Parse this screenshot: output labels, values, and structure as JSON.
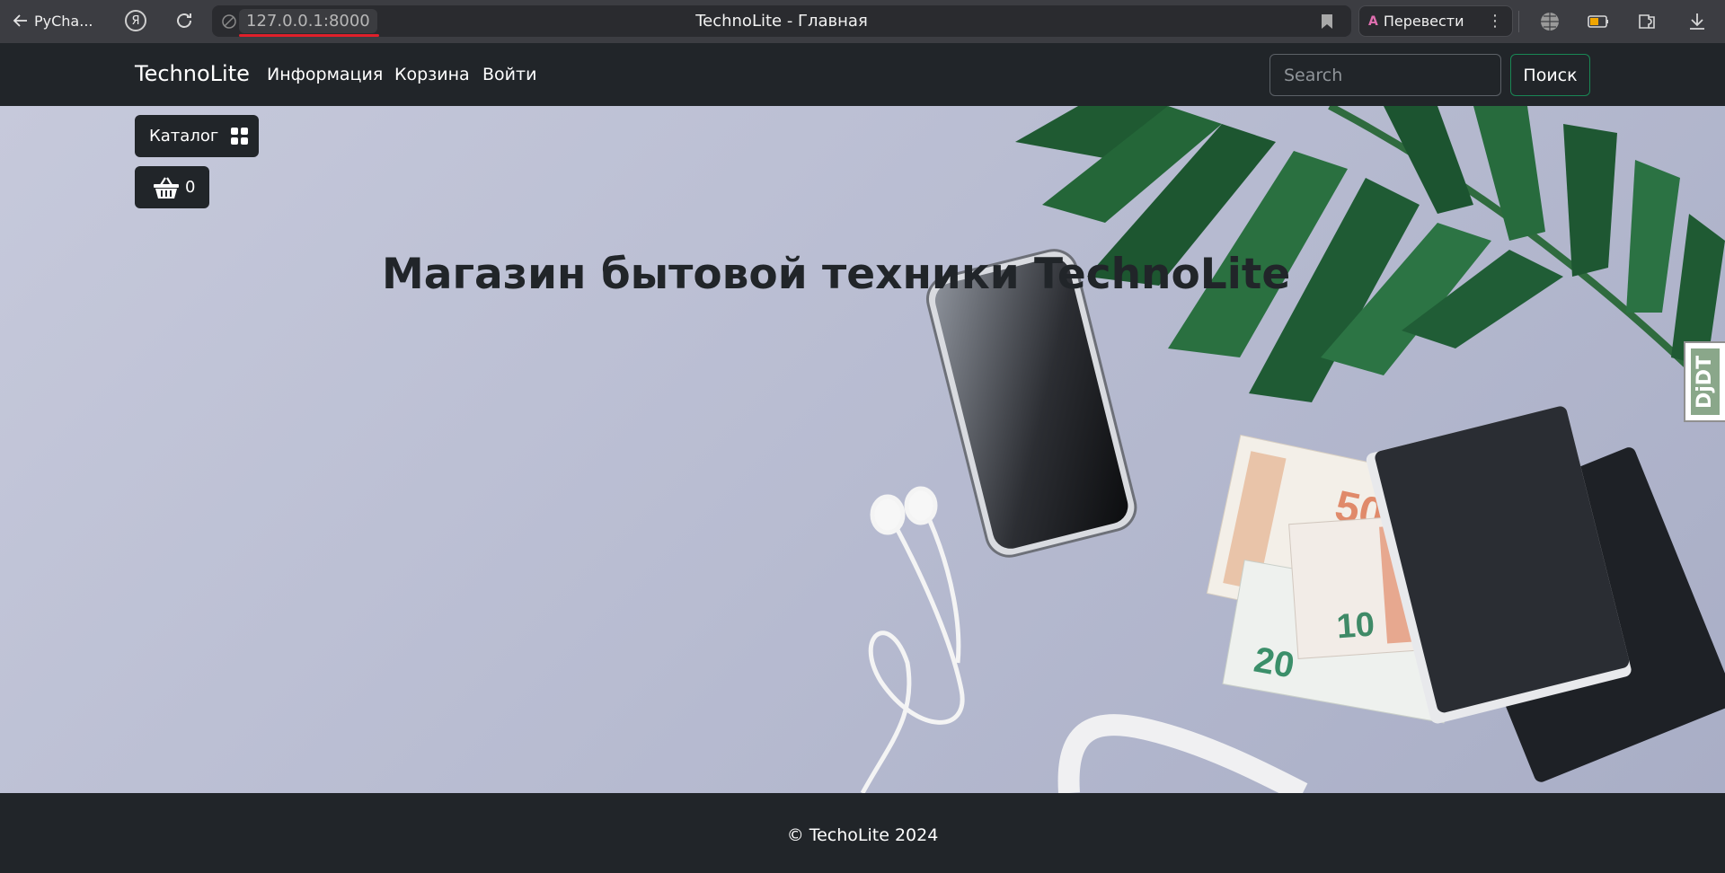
{
  "browser": {
    "back_label": "PyCha...",
    "ya_label": "Я",
    "url": "127.0.0.1:8000",
    "page_title": "TechnoLite - Главная",
    "translate_label": "Перевести",
    "translate_glyph": "A",
    "more_glyph": "⋮"
  },
  "navbar": {
    "brand": "TechnoLite",
    "links": [
      "Информация",
      "Корзина",
      "Войти"
    ],
    "search_placeholder": "Search",
    "search_button": "Поиск"
  },
  "hero": {
    "catalog_label": "Каталог",
    "cart_count": "0",
    "heading": "Магазин бытовой техники TechnoLite",
    "debug_toolbar_label": "DjDT"
  },
  "footer": {
    "copyright": "© TechoLite 2024"
  },
  "colors": {
    "navbar_bg": "#212529",
    "search_button_border": "#198754",
    "url_underline": "#e0202a"
  }
}
